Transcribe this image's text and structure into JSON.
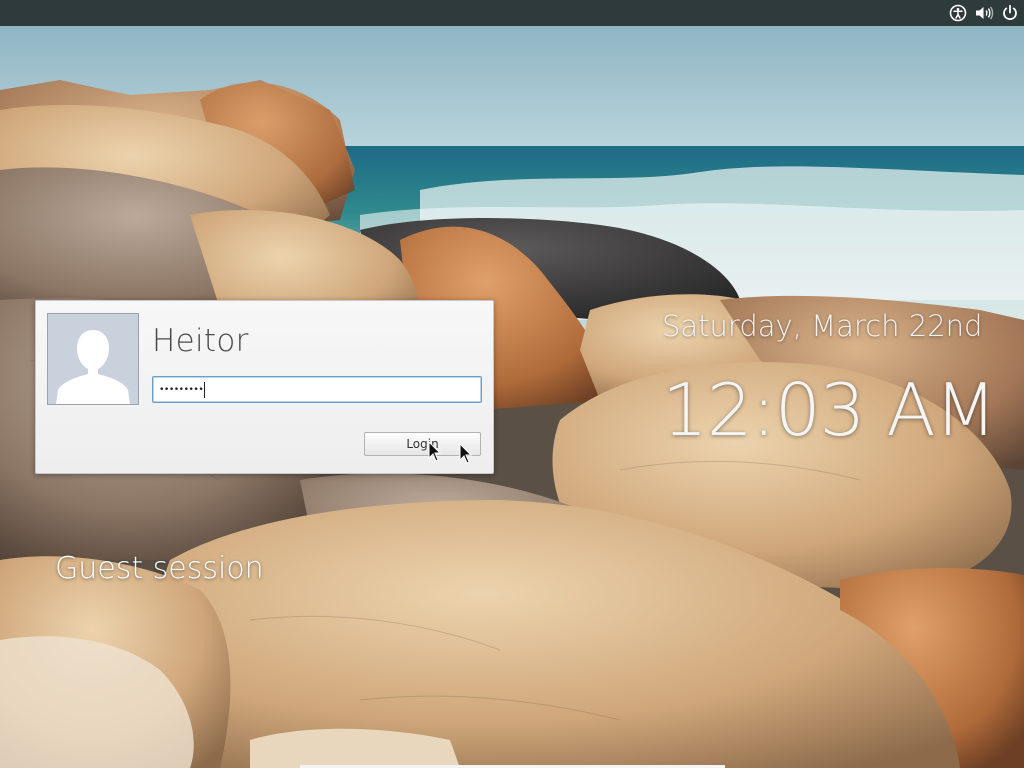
{
  "topbar": {
    "icons": [
      "accessibility-icon",
      "volume-icon",
      "power-icon"
    ]
  },
  "login": {
    "username": "Heitor",
    "password_mask": "•••••••••",
    "button_label": "Login"
  },
  "clock": {
    "date": "Saturday, March 22nd",
    "time": "12:03 AM"
  },
  "guest": {
    "label": "Guest session"
  },
  "colors": {
    "topbar": "#2f3a3d",
    "dialog": "#f2f2f2",
    "field_border": "#6b9ec9",
    "sky": "#9fc3d1",
    "sea": "#2e7e8e"
  }
}
